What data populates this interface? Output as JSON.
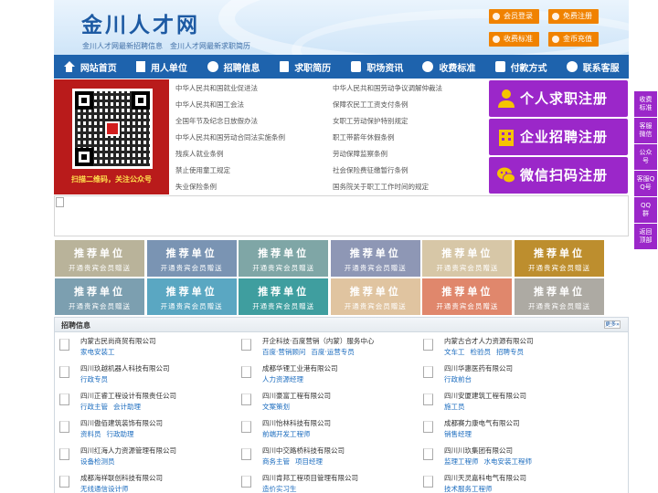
{
  "header": {
    "title": "金川人才网",
    "subtitle": "金川人才网最新招聘信息　金川人才网最新求职简历",
    "buttons": [
      "会员登录",
      "免费注册",
      "收费标准",
      "金币充值"
    ],
    "button_color": "#f08200"
  },
  "nav": {
    "items": [
      {
        "label": "网站首页",
        "icon": "home-icon"
      },
      {
        "label": "用人单位",
        "icon": "building-icon"
      },
      {
        "label": "招聘信息",
        "icon": "chat-icon"
      },
      {
        "label": "求职简历",
        "icon": "resume-icon"
      },
      {
        "label": "职场资讯",
        "icon": "news-icon"
      },
      {
        "label": "收费标准",
        "icon": "yen-icon"
      },
      {
        "label": "付款方式",
        "icon": "card-icon"
      },
      {
        "label": "联系客服",
        "icon": "phone-icon"
      }
    ],
    "color": "#1e63ad"
  },
  "qr": {
    "caption": "扫描二维码，关注公众号"
  },
  "laws": {
    "left": [
      "中华人民共和国就业促进法",
      "中华人民共和国工会法",
      "全国年节及纪念日放假办法",
      "中华人民共和国劳动合同法实施条例",
      "残疾人就业条例",
      "禁止使用童工规定",
      "失业保险条例"
    ],
    "right": [
      "中华人民共和国劳动争议调解仲裁法",
      "保障农民工工资支付条例",
      "女职工劳动保护特别规定",
      "职工带薪年休假条例",
      "劳动保障监察条例",
      "社会保险费征缴暂行条例",
      "国务院关于职工工作时间的规定"
    ]
  },
  "register": {
    "items": [
      "个人求职注册",
      "企业招聘注册",
      "微信扫码注册"
    ],
    "color": "#9b27c9"
  },
  "recommend": {
    "title": "推荐单位",
    "subtitle": "开通贵宾会员赠送",
    "colors": [
      "#b9b39a",
      "#7a94b3",
      "#7fa6a6",
      "#8e97b5",
      "#d7c7a7",
      "#bd8e2e",
      "#7c9fb0",
      "#5aa7c2",
      "#3f9e9f",
      "#e0c4a0",
      "#e0876c",
      "#adaaa3"
    ]
  },
  "jobs": {
    "title": "招聘信息",
    "more": "更多»",
    "columns": [
      [
        {
          "company": "内蒙古民尚商贸有限公司",
          "positions": [
            "家电安装工"
          ]
        },
        {
          "company": "四川玖越机器人科技有限公司",
          "positions": [
            "行政专员"
          ]
        },
        {
          "company": "四川正睿工程设计有限责任公司",
          "positions": [
            "行政主管",
            "会计助理"
          ]
        },
        {
          "company": "四川傲佰建筑装饰有限公司",
          "positions": [
            "资料员",
            "行政助理"
          ]
        },
        {
          "company": "四川红海人力资源管理有限公司",
          "positions": [
            "设备检测员"
          ]
        },
        {
          "company": "成都海祥联创科技有限公司",
          "positions": [
            "无线通信设计师"
          ]
        }
      ],
      [
        {
          "company": "开企科技·百度营销（内蒙）服务中心",
          "positions": [
            "百度·营销顾问",
            "百度·运营专员"
          ]
        },
        {
          "company": "成都华锂工业港有限公司",
          "positions": [
            "人力资源经理"
          ]
        },
        {
          "company": "四川豪富工程有限公司",
          "positions": [
            "文案策划"
          ]
        },
        {
          "company": "四川怡林科技有限公司",
          "positions": [
            "前端开发工程师"
          ]
        },
        {
          "company": "四川中交路桥科技有限公司",
          "positions": [
            "商务主管",
            "项目经理"
          ]
        },
        {
          "company": "四川肯邦工程项目管理有限公司",
          "positions": [
            "造价实习生"
          ]
        }
      ],
      [
        {
          "company": "内蒙古合才人力资源有限公司",
          "positions": [
            "文车工",
            "检验员",
            "招聘专员"
          ]
        },
        {
          "company": "四川华惠医药有限公司",
          "positions": [
            "行政前台"
          ]
        },
        {
          "company": "四川安厦建筑工程有限公司",
          "positions": [
            "施工员"
          ]
        },
        {
          "company": "成都赛力康电气有限公司",
          "positions": [
            "销售经理"
          ]
        },
        {
          "company": "四川川玖集团有限公司",
          "positions": [
            "监理工程师",
            "水电安装工程师"
          ]
        },
        {
          "company": "四川天灵嘉科电气有限公司",
          "positions": [
            "技术服务工程师"
          ]
        }
      ]
    ]
  },
  "side": {
    "items": [
      "收费标准",
      "客服微信",
      "公众号",
      "客服QQ号",
      "QQ群",
      "返回顶部"
    ],
    "color": "#9b27c9"
  }
}
